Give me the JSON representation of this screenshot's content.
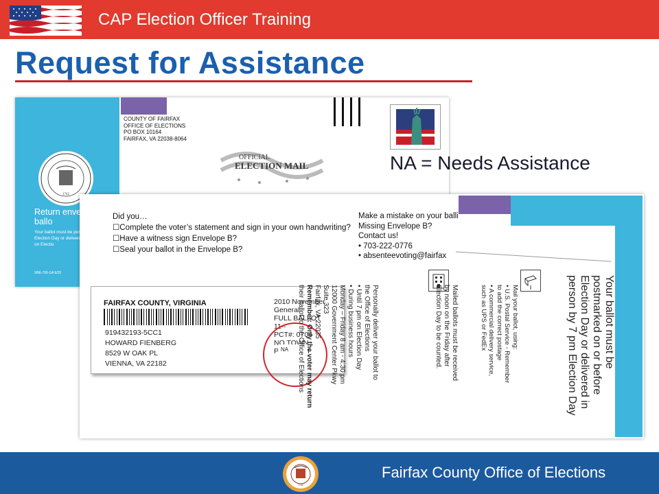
{
  "header": {
    "title": "CAP Election Officer Training",
    "flag_icon": "us-flag-icon",
    "bar_color": "#e23a2e"
  },
  "slide": {
    "title": "Request for Assistance",
    "title_color": "#1b5fae",
    "na_note": "NA = Needs Assistance"
  },
  "back_envelope": {
    "address_lines": [
      "COUNTY OF FAIRFAX",
      "OFFICE OF ELECTIONS",
      "PO BOX 10164",
      "FAIRFAX, VA 22038-8064"
    ],
    "return_text": "Return enve official ballo",
    "fine_print": "Your ballot must be postmarked on or Election Day or delivered perso by 7 pm on Electio",
    "form_code": "SBE-706-SA 6/20",
    "seal_icon": "fairfax-county-seal-icon",
    "election_mail_icon": "official-election-mail-logo",
    "teal_color": "#3eb5dd"
  },
  "front_envelope": {
    "did_you_heading": "Did you…",
    "checklist": [
      "☐Complete the voter’s statement and sign in your own handwriting?",
      "☐Have a witness sign Envelope B?",
      "☐Seal your ballot in the Envelope B?"
    ],
    "mistake_lines": [
      "Make a mistake on your balli",
      "Missing Envelope B?",
      "Contact us!",
      "• 703-222-0776",
      "• absenteevoting@fairfax"
    ],
    "label": {
      "county": "FAIRFAX COUNTY, VIRGINIA",
      "recipient_lines": [
        "919432193-5CC1",
        "HOWARD FIENBERG",
        "8529 W OAK PL",
        "VIENNA, VA 22182"
      ],
      "ballot_lines": [
        "2010 November General",
        "FULL BALLOT",
        "11--",
        "PCT#: 0704",
        "NO TOWN PRECINCT"
      ],
      "na_mark": "NA"
    },
    "col_deliver": [
      "Personally deliver your ballot to",
      "the Office of Elections",
      "• Until 7 pm on Election Day",
      "• During business hours",
      "  Monday – Friday 8 am - 4:30 pm",
      "12000 Government Center Pkwy",
      "Suite 323",
      "Fairfax, VA 22035",
      "Remember: Only the voter may return",
      "their ballot to the Office of Elections"
    ],
    "col_mailed": [
      "Mailed ballots must be received",
      "by noon on the Friday after",
      "Election Day to be counted."
    ],
    "col_mail": [
      "Mail your ballot, using:",
      "• U.S. Postal Service - Remember",
      "  to add the correct postage",
      "• A commercial delivery service,",
      "  such as UPS or FedEx"
    ],
    "col_big": [
      "Your ballot must be",
      "postmarked on or before",
      "Election Day or delivered in",
      "person by 7 pm Election Day"
    ],
    "building_icon": "building-icon",
    "mailbox_icon": "mailbox-icon",
    "accent_purple": "#7a63a8"
  },
  "footer": {
    "text": "Fairfax County Office of Elections",
    "seal_icon": "fairfax-county-seal-icon",
    "bar_color": "#1c5a9e"
  }
}
